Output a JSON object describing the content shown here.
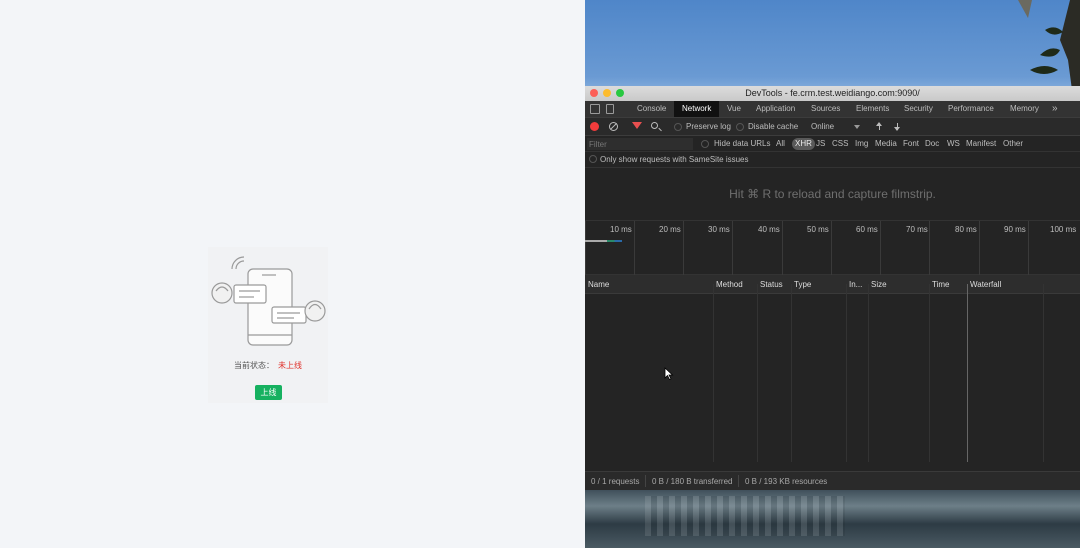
{
  "app": {
    "status_label": "当前状态：",
    "status_value": "未上线",
    "online_button": "上线",
    "colors": {
      "status_value": "#e0302a",
      "button_bg": "#16b160"
    }
  },
  "devtools": {
    "window_title": "DevTools - fe.crm.test.weidiango.com:9090/",
    "tabs": [
      "Console",
      "Network",
      "Vue",
      "Application",
      "Sources",
      "Elements",
      "Security",
      "Performance",
      "Memory"
    ],
    "active_tab": "Network",
    "more_tabs_icon": "double-chevron-right-icon",
    "toolbar": {
      "preserve_log": "Preserve log",
      "disable_cache": "Disable cache",
      "throttling": "Online"
    },
    "filter": {
      "placeholder": "Filter",
      "hide_data_urls": "Hide data URLs",
      "types": [
        "All",
        "XHR",
        "JS",
        "CSS",
        "Img",
        "Media",
        "Font",
        "Doc",
        "WS",
        "Manifest",
        "Other"
      ],
      "active_type": "XHR",
      "samesite": "Only show requests with SameSite issues"
    },
    "filmstrip_hint": "Hit ⌘ R to reload and capture filmstrip.",
    "timeline_ticks": [
      "10 ms",
      "20 ms",
      "30 ms",
      "40 ms",
      "50 ms",
      "60 ms",
      "70 ms",
      "80 ms",
      "90 ms",
      "100 ms"
    ],
    "columns": [
      "Name",
      "Method",
      "Status",
      "Type",
      "In...",
      "Size",
      "Time",
      "Waterfall"
    ],
    "status": {
      "requests": "0 / 1 requests",
      "transferred": "0 B / 180 B transferred",
      "resources": "0 B / 193 KB resources"
    },
    "colors": {
      "record": "#f23c3c",
      "filter_active": "#e84f4f"
    }
  }
}
